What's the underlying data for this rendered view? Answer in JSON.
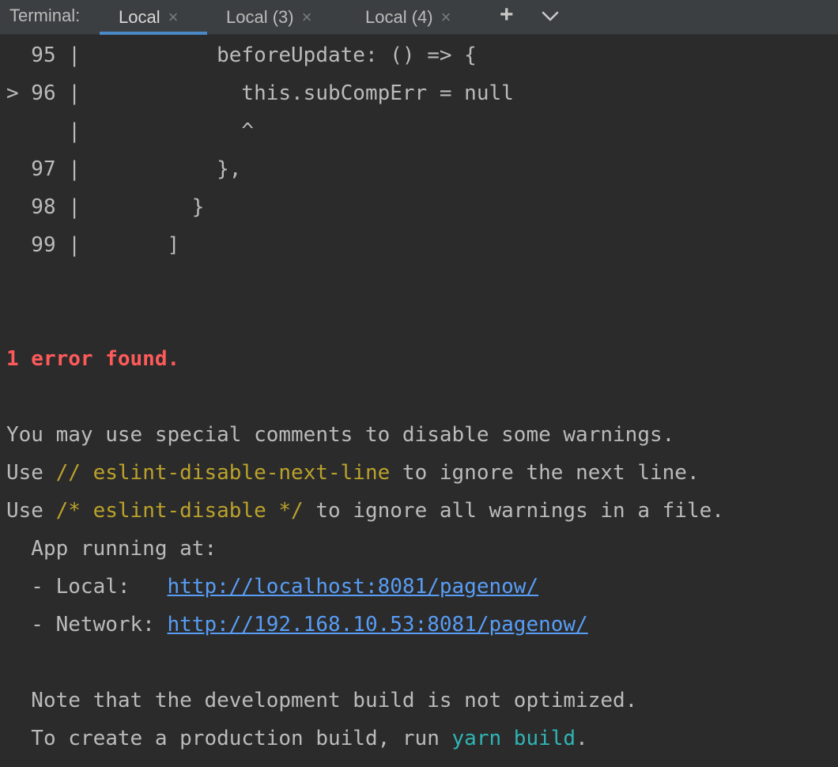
{
  "tabbar": {
    "title": "Terminal:",
    "tabs": [
      {
        "label": "Local",
        "close": "×"
      },
      {
        "label": "Local (3)",
        "close": "×"
      },
      {
        "label": "Local (4)",
        "close": "×"
      }
    ],
    "add_label": "+",
    "active_tab_color": "#4a88c7"
  },
  "terminal": {
    "code_lines": [
      "  95 |           beforeUpdate: () => {",
      "> 96 |             this.subCompErr = null",
      "     |             ^",
      "  97 |           },",
      "  98 |         }",
      "  99 |       ]"
    ],
    "error_summary": "1 error found.",
    "hint_line1": "You may use special comments to disable some warnings.",
    "hint_line2": {
      "prefix": "Use ",
      "code": "// eslint-disable-next-line",
      "suffix": " to ignore the next line."
    },
    "hint_line3": {
      "prefix": "Use ",
      "code": "/* eslint-disable */",
      "suffix": " to ignore all warnings in a file."
    },
    "app_running": "  App running at:",
    "local": {
      "label": "  - Local:   ",
      "url": "http://localhost:8081/pagenow/"
    },
    "network": {
      "label": "  - Network: ",
      "url": "http://192.168.10.53:8081/pagenow/"
    },
    "note_line": "  Note that the development build is not optimized.",
    "build_line": {
      "prefix": "  To create a production build, run ",
      "cmd": "yarn build",
      "suffix": "."
    },
    "colors": {
      "error": "#ff5a5a",
      "code_comment": "#bba22b",
      "link": "#589df6",
      "command": "#2fb5b5"
    }
  }
}
